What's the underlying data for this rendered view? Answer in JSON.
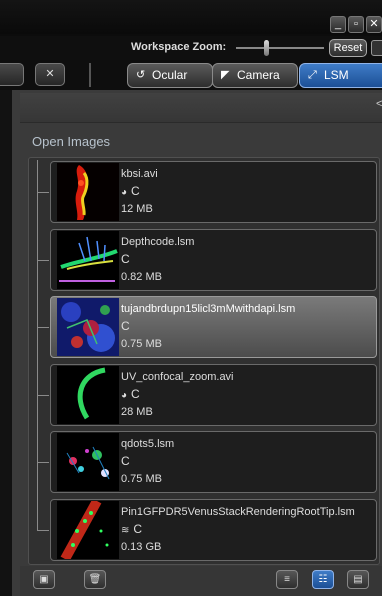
{
  "window": {
    "buttons": [
      {
        "icon": "minimize-icon",
        "glyph": "_"
      },
      {
        "icon": "restore-icon",
        "glyph": "▫"
      },
      {
        "icon": "close-icon",
        "glyph": "✕"
      }
    ]
  },
  "workspace_zoom": {
    "label": "Workspace Zoom:",
    "reset_label": "Reset",
    "level": 0.33
  },
  "toolbar": {
    "close_glyph": "✕"
  },
  "tabs": [
    {
      "label": "Ocular",
      "icon": "ocular-icon",
      "glyph": "↺",
      "active": false
    },
    {
      "label": "Camera",
      "icon": "camera-icon",
      "glyph": "◤",
      "active": false
    },
    {
      "label": "LSM",
      "icon": "lsm-icon",
      "glyph": "⤢",
      "active": true
    }
  ],
  "panel": {
    "section_title": "Open Images"
  },
  "images": [
    {
      "name": "kbsi.avi",
      "channel": "C",
      "channel_icon": "movie-icon",
      "channel_glyph": "◕",
      "size": "12 MB",
      "selected": false
    },
    {
      "name": "Depthcode.lsm",
      "channel": "C",
      "channel_icon": "",
      "channel_glyph": "",
      "size": "0.82 MB",
      "selected": false
    },
    {
      "name": "tujandbrdupn15licl3mMwithdapi.lsm",
      "channel": "C",
      "channel_icon": "",
      "channel_glyph": "",
      "size": "0.75 MB",
      "selected": true
    },
    {
      "name": "UV_confocal_zoom.avi",
      "channel": "C",
      "channel_icon": "movie-icon",
      "channel_glyph": "◕",
      "size": "28 MB",
      "selected": false
    },
    {
      "name": "qdots5.lsm",
      "channel": "C",
      "channel_icon": "",
      "channel_glyph": "",
      "size": "0.75 MB",
      "selected": false
    },
    {
      "name": "Pin1GFPDR5VenusStackRenderingRootTip.lsm",
      "channel": "C",
      "channel_icon": "stack-icon",
      "channel_glyph": "≋",
      "size": "0.13 GB",
      "selected": false
    }
  ],
  "bottom_toolbar": {
    "save_glyph": "▣",
    "delete_glyph": "🗑",
    "views": [
      {
        "icon": "list-view-icon",
        "glyph": "≡",
        "active": false
      },
      {
        "icon": "detail-view-icon",
        "glyph": "☷",
        "active": true
      },
      {
        "icon": "compact-view-icon",
        "glyph": "▤",
        "active": false
      }
    ]
  }
}
